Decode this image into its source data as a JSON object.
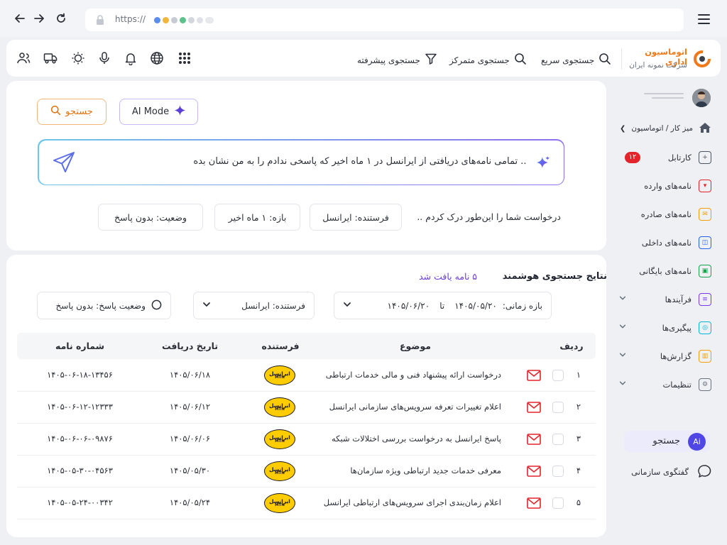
{
  "browser": {
    "url": "https://"
  },
  "toolbar": {
    "quick_search": "جستجوی سریع",
    "focused_search": "جستجوی متمرکز",
    "advanced_search": "جستجوی پیشرفته",
    "brand_title": "اتوماسیون اداری",
    "brand_subtitle": "شرکت نمونه ایران",
    "icons": [
      "users-icon",
      "truck-icon",
      "sun-icon",
      "microphone-icon",
      "bell-icon",
      "globe-icon",
      "apps-grid-icon"
    ]
  },
  "search_panel": {
    "ai_mode_label": "AI Mode",
    "search_button": "جستجو",
    "prompt": ".. تمامی نامه‌های دریافتی از ایرانسل در ۱ ماه اخیر که پاسخی ندادم را به من نشان بده",
    "understood": "درخواست شما را این‌طور درک کردم ..",
    "chips": {
      "sender": "فرستنده: ایرانسل",
      "period": "بازه: ۱ ماه اخیر",
      "status": "وضعیت: بدون پاسخ"
    }
  },
  "results": {
    "title": "نتایج جستجوی هوشمند",
    "count": "۵ نامه یافت شد",
    "filters": {
      "date_label": "بازه زمانی:",
      "date_from": "۱۴۰۵/۰۵/۲۰",
      "date_to_word": "تا",
      "date_to": "۱۴۰۵/۰۶/۲۰",
      "sender": "فرستنده: ایرانسل",
      "reply_status": "وضعیت پاسخ: بدون پاسخ"
    },
    "columns": {
      "row": "ردیف",
      "subject": "موضوع",
      "sender": "فرستنده",
      "date": "تاریخ دریافت",
      "number": "شماره نامه"
    },
    "sender_logo": {
      "line1": "ایرانسل",
      "line2": "MTN"
    },
    "rows": [
      {
        "index": "۱",
        "subject": "درخواست ارائه پیشنهاد فنی و مالی خدمات ارتباطی",
        "date": "۱۴۰۵/۰۶/۱۸",
        "number": "۱۴۰۵-۰۶-۱۸-۱۳۴۵۶"
      },
      {
        "index": "۲",
        "subject": "اعلام تغییرات تعرفه سرویس‌های سازمانی ایرانسل",
        "date": "۱۴۰۵/۰۶/۱۲",
        "number": "۱۴۰۵-۰۶-۱۲-۱۲۳۳۳"
      },
      {
        "index": "۳",
        "subject": "پاسخ ایرانسل به درخواست بررسی اختلالات شبکه",
        "date": "۱۴۰۵/۰۶/۰۶",
        "number": "۱۴۰۵-۰۶-۰۶-۰۹۸۷۶"
      },
      {
        "index": "۴",
        "subject": "معرفی خدمات جدید ارتباطی ویژه سازمان‌ها",
        "date": "۱۴۰۵/۰۵/۳۰",
        "number": "۱۴۰۵-۰۵-۳۰-۰۴۵۶۳"
      },
      {
        "index": "۵",
        "subject": "اعلام زمان‌بندی اجرای سرویس‌های ارتباطی ایرانسل",
        "date": "۱۴۰۵/۰۵/۲۴",
        "number": "۱۴۰۵-۰۵-۲۴-۰۰۳۴۲"
      }
    ]
  },
  "sidebar": {
    "breadcrumb": "میز کار / اتوماسیون",
    "items": [
      {
        "label": "کارتابل",
        "badge": "۱۲",
        "icon": "plus-square-icon",
        "color": "#4b5563"
      },
      {
        "label": "نامه‌های وارده",
        "icon": "inbox-in-icon",
        "color": "#e3242b"
      },
      {
        "label": "نامه‌های صادره",
        "icon": "mail-out-icon",
        "color": "#f59e0b"
      },
      {
        "label": "نامه‌های داخلی",
        "icon": "internal-mail-icon",
        "color": "#2563eb"
      },
      {
        "label": "نامه‌های بایگانی",
        "icon": "archive-icon",
        "color": "#16a34a"
      },
      {
        "label": "فرآیندها",
        "icon": "process-icon",
        "color": "#7c3aed"
      },
      {
        "label": "پیگیری‌ها",
        "icon": "followup-icon",
        "color": "#06b6d4"
      },
      {
        "label": "گزارش‌ها",
        "icon": "chart-icon",
        "color": "#f59e0b"
      },
      {
        "label": "تنظیمات",
        "icon": "settings-icon",
        "color": "#6b7280"
      }
    ],
    "search": "جستجو",
    "ai_badge": "Ai",
    "chat": "گفتگوی سازمانی"
  }
}
